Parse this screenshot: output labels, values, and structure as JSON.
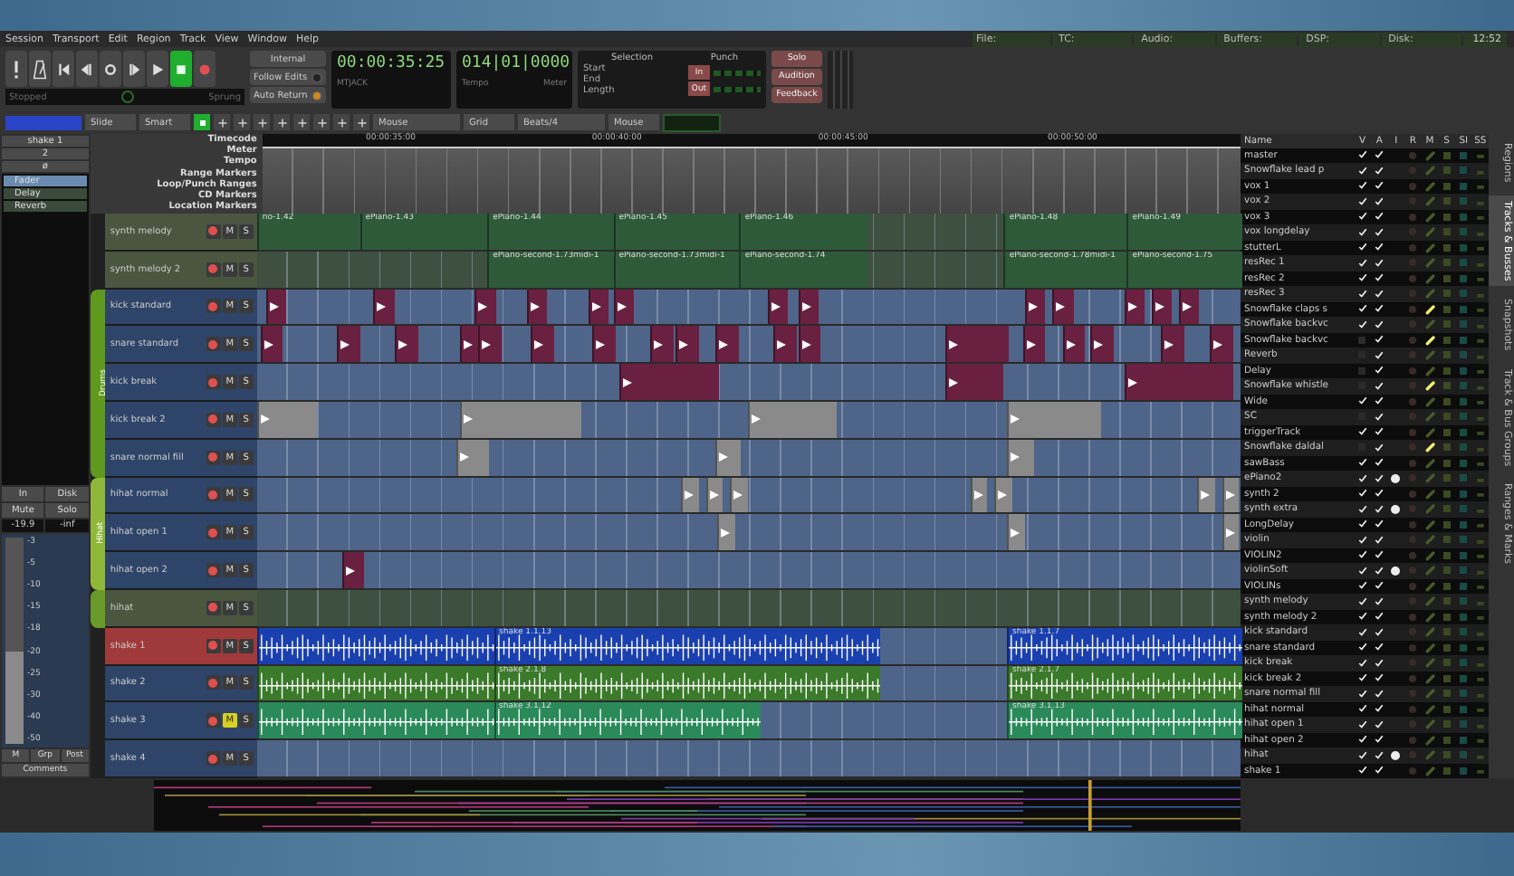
{
  "menu": [
    "Session",
    "Transport",
    "Edit",
    "Region",
    "Track",
    "View",
    "Window",
    "Help"
  ],
  "status_bar": {
    "items": [
      "File:",
      "TC:",
      "Audio:",
      "Buffers:",
      "DSP:",
      "Disk:"
    ],
    "time": "12:52"
  },
  "transport": {
    "buttons": [
      {
        "kind": "alert",
        "on": false
      },
      {
        "kind": "metronome",
        "on": false
      },
      {
        "kind": "start",
        "on": false
      },
      {
        "kind": "prev",
        "on": false
      },
      {
        "kind": "loop",
        "on": false
      },
      {
        "kind": "next",
        "on": false
      },
      {
        "kind": "play",
        "on": false
      },
      {
        "kind": "stop",
        "on": true
      },
      {
        "kind": "record",
        "on": false
      }
    ],
    "state": "Stopped",
    "shuttle": "Sprung",
    "sync": "Internal",
    "toggles": [
      {
        "label": "Follow Edits",
        "on": false
      },
      {
        "label": "Auto Return",
        "on": true
      }
    ]
  },
  "primary_clock": {
    "time": "00:00:35:25",
    "source": "MTJACK"
  },
  "secondary_clock": {
    "time": "014|01|0000",
    "fields": [
      "Tempo",
      "Meter"
    ]
  },
  "selection": {
    "title": "Selection",
    "rows": [
      "Start",
      "End",
      "Length"
    ]
  },
  "punch": {
    "title": "Punch",
    "buttons": [
      "In",
      "Out"
    ]
  },
  "monitor_buttons": [
    "Solo",
    "Audition",
    "Feedback"
  ],
  "edit_toolbar": {
    "edit_mode": "Slide",
    "tool": "Smart",
    "smart_on": true,
    "edit_point": "Mouse",
    "snap": "Grid",
    "grid": "Beats/4",
    "zoom_focus": "Mouse"
  },
  "editor_strip": {
    "name": "shake 1",
    "inputs": [
      "2",
      "ø"
    ],
    "plugins": [
      {
        "name": "Fader",
        "on": true
      },
      {
        "name": "Delay",
        "on": false
      },
      {
        "name": "Reverb",
        "on": false
      }
    ],
    "buttons": [
      "In",
      "Disk",
      "Mute",
      "Solo"
    ],
    "gain": "-19.9",
    "peak": "-inf",
    "scale": [
      "-3",
      "-5",
      "-10",
      "-15",
      "-18",
      "-20",
      "-25",
      "-30",
      "-40",
      "-50"
    ],
    "level": 0.45,
    "bottom": [
      "M",
      "Grp",
      "Post"
    ],
    "comments": "Comments"
  },
  "rulers": [
    "Timecode",
    "Meter",
    "Tempo",
    "Range Markers",
    "Loop/Punch Ranges",
    "CD Markers",
    "Location Markers"
  ],
  "timecode_marks": [
    "00:00:35:00",
    "00:00:40:00",
    "00:00:45:00",
    "00:00:50:00"
  ],
  "track_sections": [
    {
      "tracks": [
        {
          "name": "synth melody",
          "kind": "midi-bus",
          "selected": false,
          "muted": false,
          "mute": "M",
          "solo": "S",
          "regions": [
            {
              "label": "no-1.42"
            },
            {
              "label": "ePiano-1.43"
            },
            {
              "label": "ePiano-1.44"
            },
            {
              "label": "ePiano-1.45"
            },
            {
              "label": "ePiano-1.46"
            },
            {
              "label": "ePiano-1.48"
            },
            {
              "label": "ePiano-1.49"
            }
          ]
        },
        {
          "name": "synth melody 2",
          "kind": "midi-bus",
          "selected": false,
          "muted": false,
          "mute": "M",
          "solo": "S",
          "regions": [
            {
              "label": "ePiano-second-1.73midi-1"
            },
            {
              "label": "ePiano-second-1.73midi-1"
            },
            {
              "label": "ePiano-second-1.74"
            },
            {
              "label": "ePiano-second-1.78midi-1"
            },
            {
              "label": "ePiano-second-1.75"
            }
          ]
        }
      ]
    },
    {
      "group": {
        "name": "Drums",
        "color": "#5f9a1e"
      },
      "tracks": [
        {
          "name": "kick standard",
          "kind": "drum",
          "selected": false,
          "muted": false,
          "mute": "M",
          "solo": "S"
        },
        {
          "name": "snare standard",
          "kind": "drum",
          "selected": false,
          "muted": false,
          "mute": "M",
          "solo": "S"
        },
        {
          "name": "kick break",
          "kind": "drum",
          "selected": false,
          "muted": false,
          "mute": "M",
          "solo": "S"
        },
        {
          "name": "kick break 2",
          "kind": "drum-alt",
          "selected": false,
          "muted": false,
          "mute": "M",
          "solo": "S"
        },
        {
          "name": "snare normal fill",
          "kind": "drum-alt",
          "selected": false,
          "muted": false,
          "mute": "M",
          "solo": "S"
        }
      ]
    },
    {
      "group": {
        "name": "Hihat",
        "color": "#8fb83a"
      },
      "tracks": [
        {
          "name": "hihat normal",
          "kind": "drum-alt",
          "selected": false,
          "muted": false,
          "mute": "M",
          "solo": "S"
        },
        {
          "name": "hihat open 1",
          "kind": "drum-alt",
          "selected": false,
          "muted": false,
          "mute": "M",
          "solo": "S"
        },
        {
          "name": "hihat open 2",
          "kind": "drum",
          "selected": false,
          "muted": false,
          "mute": "M",
          "solo": "S"
        }
      ]
    },
    {
      "group": {
        "color": "#6a9a2a"
      },
      "tracks": [
        {
          "name": "hihat",
          "kind": "midi-bus",
          "selected": false,
          "muted": false,
          "mute": "M",
          "solo": "S"
        }
      ]
    },
    {
      "tracks": [
        {
          "name": "shake 1",
          "kind": "audio-blue",
          "selected": true,
          "muted": false,
          "mute": "M",
          "solo": "S",
          "regions": [
            {
              "label": "shake 1.1.13"
            },
            {
              "label": "shake 1.1.7"
            }
          ]
        },
        {
          "name": "shake 2",
          "kind": "audio-green",
          "selected": false,
          "muted": false,
          "mute": "M",
          "solo": "S",
          "regions": [
            {
              "label": "shake 2.1.8"
            },
            {
              "label": "shake 2.1.7"
            }
          ]
        },
        {
          "name": "shake 3",
          "kind": "audio-teal",
          "selected": false,
          "muted": true,
          "mute": "M",
          "solo": "S",
          "regions": [
            {
              "label": "shake 3.1.12"
            },
            {
              "label": "shake 3.1.13"
            }
          ]
        },
        {
          "name": "shake 4",
          "kind": "audio-blue",
          "selected": false,
          "muted": false,
          "mute": "M",
          "solo": "S"
        }
      ]
    }
  ],
  "track_list": {
    "columns": [
      "Name",
      "V",
      "A",
      "I",
      "R",
      "M",
      "S",
      "SI",
      "SS"
    ],
    "rows": [
      {
        "name": "master",
        "visible": true,
        "active": true,
        "input": false,
        "monitor": false
      },
      {
        "name": "Snowflake lead p",
        "visible": true,
        "active": true,
        "input": false,
        "monitor": false
      },
      {
        "name": "vox 1",
        "visible": true,
        "active": true,
        "input": false,
        "monitor": false
      },
      {
        "name": "vox 2",
        "visible": true,
        "active": true,
        "input": false,
        "monitor": false
      },
      {
        "name": "vox 3",
        "visible": true,
        "active": true,
        "input": false,
        "monitor": false
      },
      {
        "name": "vox longdelay",
        "visible": true,
        "active": true,
        "input": false,
        "monitor": false
      },
      {
        "name": "stutterL",
        "visible": true,
        "active": true,
        "input": false,
        "monitor": false
      },
      {
        "name": "resRec 1",
        "visible": true,
        "active": true,
        "input": false,
        "monitor": false
      },
      {
        "name": "resRec 2",
        "visible": true,
        "active": true,
        "input": false,
        "monitor": false
      },
      {
        "name": "resRec 3",
        "visible": true,
        "active": true,
        "input": false,
        "monitor": false
      },
      {
        "name": "Snowflake claps s",
        "visible": true,
        "active": true,
        "input": false,
        "monitor": true
      },
      {
        "name": "Snowflake backvc",
        "visible": true,
        "active": true,
        "input": false,
        "monitor": false
      },
      {
        "name": "Snowflake backvc",
        "visible": false,
        "active": true,
        "input": false,
        "monitor": true
      },
      {
        "name": "Reverb",
        "visible": false,
        "active": true,
        "input": false,
        "monitor": false
      },
      {
        "name": "Delay",
        "visible": false,
        "active": true,
        "input": false,
        "monitor": false
      },
      {
        "name": "Snowflake whistle",
        "visible": false,
        "active": true,
        "input": false,
        "monitor": true
      },
      {
        "name": "Wide",
        "visible": true,
        "active": true,
        "input": false,
        "monitor": false
      },
      {
        "name": "SC",
        "visible": false,
        "active": true,
        "input": false,
        "monitor": false
      },
      {
        "name": "triggerTrack",
        "visible": true,
        "active": true,
        "input": false,
        "monitor": false
      },
      {
        "name": "Snowflake daldal",
        "visible": false,
        "active": true,
        "input": false,
        "monitor": true
      },
      {
        "name": "sawBass",
        "visible": true,
        "active": true,
        "input": false,
        "monitor": false
      },
      {
        "name": "ePiano2",
        "visible": true,
        "active": true,
        "input": true,
        "monitor": false
      },
      {
        "name": "synth 2",
        "visible": true,
        "active": true,
        "input": false,
        "monitor": false
      },
      {
        "name": "synth extra",
        "visible": true,
        "active": true,
        "input": true,
        "monitor": false
      },
      {
        "name": "LongDelay",
        "visible": true,
        "active": true,
        "input": false,
        "monitor": false
      },
      {
        "name": "violin",
        "visible": true,
        "active": true,
        "input": false,
        "monitor": false
      },
      {
        "name": "VIOLIN2",
        "visible": true,
        "active": true,
        "input": false,
        "monitor": false
      },
      {
        "name": "violinSoft",
        "visible": true,
        "active": true,
        "input": true,
        "monitor": false
      },
      {
        "name": "VIOLINs",
        "visible": true,
        "active": true,
        "input": false,
        "monitor": false
      },
      {
        "name": "synth melody",
        "visible": true,
        "active": true,
        "input": false,
        "monitor": false
      },
      {
        "name": "synth melody 2",
        "visible": true,
        "active": true,
        "input": false,
        "monitor": false
      },
      {
        "name": "kick standard",
        "visible": true,
        "active": true,
        "input": false,
        "monitor": false
      },
      {
        "name": "snare standard",
        "visible": true,
        "active": true,
        "input": false,
        "monitor": false
      },
      {
        "name": "kick break",
        "visible": true,
        "active": true,
        "input": false,
        "monitor": false
      },
      {
        "name": "kick break 2",
        "visible": true,
        "active": true,
        "input": false,
        "monitor": false
      },
      {
        "name": "snare normal fill",
        "visible": true,
        "active": true,
        "input": false,
        "monitor": false
      },
      {
        "name": "hihat normal",
        "visible": true,
        "active": true,
        "input": false,
        "monitor": false
      },
      {
        "name": "hihat open 1",
        "visible": true,
        "active": true,
        "input": false,
        "monitor": false
      },
      {
        "name": "hihat open 2",
        "visible": true,
        "active": true,
        "input": false,
        "monitor": false
      },
      {
        "name": "hihat",
        "visible": true,
        "active": true,
        "input": true,
        "monitor": false
      },
      {
        "name": "shake 1",
        "visible": true,
        "active": true,
        "input": false,
        "monitor": false
      }
    ]
  },
  "side_tabs": [
    {
      "label": "Regions",
      "selected": false
    },
    {
      "label": "Tracks & Busses",
      "selected": true
    },
    {
      "label": "Snapshots",
      "selected": false
    },
    {
      "label": "Track & Bus Groups",
      "selected": false
    },
    {
      "label": "Ranges & Marks",
      "selected": false
    }
  ]
}
